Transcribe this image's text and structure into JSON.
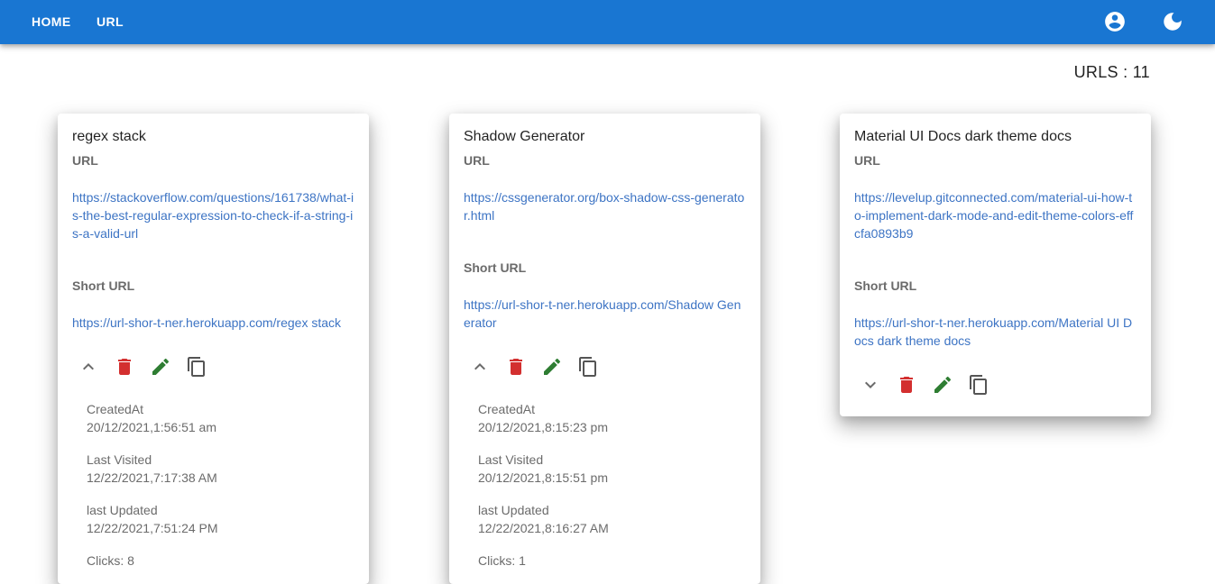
{
  "nav": {
    "home": "HOME",
    "url": "URL"
  },
  "count_text": "URLS : 11",
  "labels": {
    "url": "URL",
    "short_url": "Short URL",
    "created": "CreatedAt",
    "visited": "Last Visited",
    "updated": "last Updated"
  },
  "colors": {
    "appbar": "#1976d2",
    "link": "#3d74c4",
    "delete": "#d32f2f",
    "edit": "#2e7d32"
  },
  "cards": [
    {
      "title": "regex stack",
      "url": "https://stackoverflow.com/questions/161738/what-is-the-best-regular-expression-to-check-if-a-string-is-a-valid-url",
      "short_url": "https://url-shor-t-ner.herokuapp.com/regex stack",
      "expanded": true,
      "created": "20/12/2021,1:56:51 am",
      "visited": "12/22/2021,7:17:38 AM",
      "updated": "12/22/2021,7:51:24 PM",
      "clicks": "Clicks: 8"
    },
    {
      "title": "Shadow Generator",
      "url": "https://cssgenerator.org/box-shadow-css-generator.html",
      "short_url": "https://url-shor-t-ner.herokuapp.com/Shadow Generator",
      "expanded": true,
      "created": "20/12/2021,8:15:23 pm",
      "visited": "20/12/2021,8:15:51 pm",
      "updated": "12/22/2021,8:16:27 AM",
      "clicks": "Clicks: 1"
    },
    {
      "title": "Material UI Docs dark theme docs",
      "url": "https://levelup.gitconnected.com/material-ui-how-to-implement-dark-mode-and-edit-theme-colors-effcfa0893b9",
      "short_url": "https://url-shor-t-ner.herokuapp.com/Material UI Docs dark theme docs",
      "expanded": false
    }
  ]
}
